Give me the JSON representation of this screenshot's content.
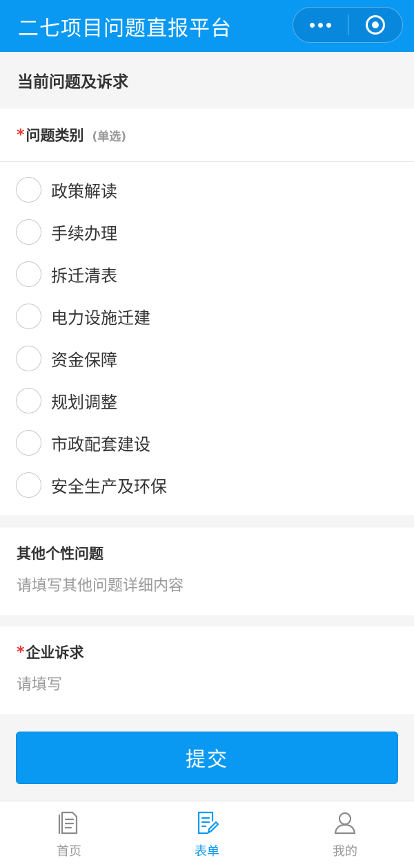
{
  "header": {
    "title": "二七项目问题直报平台",
    "more_icon": "more-dots-icon",
    "close_icon": "target-circle-icon",
    "color": "#0a99f2"
  },
  "section": {
    "title": "当前问题及诉求"
  },
  "category": {
    "required_mark": "*",
    "label": "问题类别",
    "hint": "(单选)",
    "options": [
      "政策解读",
      "手续办理",
      "拆迁清表",
      "电力设施迁建",
      "资金保障",
      "规划调整",
      "市政配套建设",
      "安全生产及环保"
    ]
  },
  "other": {
    "label": "其他个性问题",
    "placeholder": "请填写其他问题详细内容",
    "value": ""
  },
  "appeal": {
    "required_mark": "*",
    "label": "企业诉求",
    "placeholder": "请填写",
    "value": ""
  },
  "submit": {
    "label": "提交"
  },
  "tabbar": {
    "items": [
      {
        "label": "首页",
        "icon": "document-icon",
        "active": false
      },
      {
        "label": "表单",
        "icon": "form-edit-icon",
        "active": true
      },
      {
        "label": "我的",
        "icon": "user-icon",
        "active": false
      }
    ],
    "active_color": "#0a99f2",
    "inactive_color": "#999999"
  }
}
